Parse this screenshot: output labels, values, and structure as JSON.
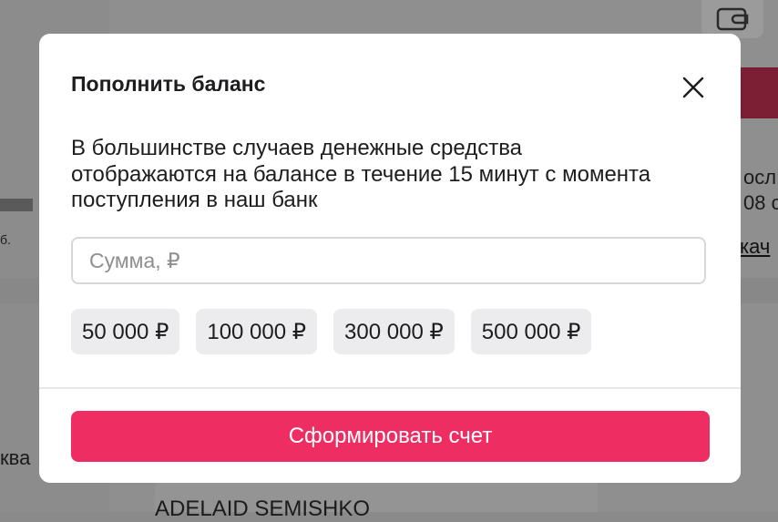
{
  "background": {
    "partial_texts": {
      "left_small": "б.",
      "left_word": "ква",
      "right_line1": "осл",
      "right_line2": "08 с",
      "right_link": "кач",
      "bottom_name": "ADELAID SEMISHKO"
    },
    "wallet_icon": "wallet-icon"
  },
  "modal": {
    "title": "Пополнить баланс",
    "close_icon": "close-icon",
    "description": "В большинстве случаев денежные средства отображаются на балансе в течение 15 минут с момента поступления в наш банк",
    "amount_input": {
      "placeholder": "Сумма, ₽",
      "value": ""
    },
    "quick_amounts": [
      "50 000 ₽",
      "100 000 ₽",
      "300 000 ₽",
      "500 000 ₽"
    ],
    "submit_label": "Сформировать счет"
  },
  "colors": {
    "accent": "#ee2e63",
    "overlay": "#8f8f8f",
    "chip_bg": "#ececee"
  }
}
